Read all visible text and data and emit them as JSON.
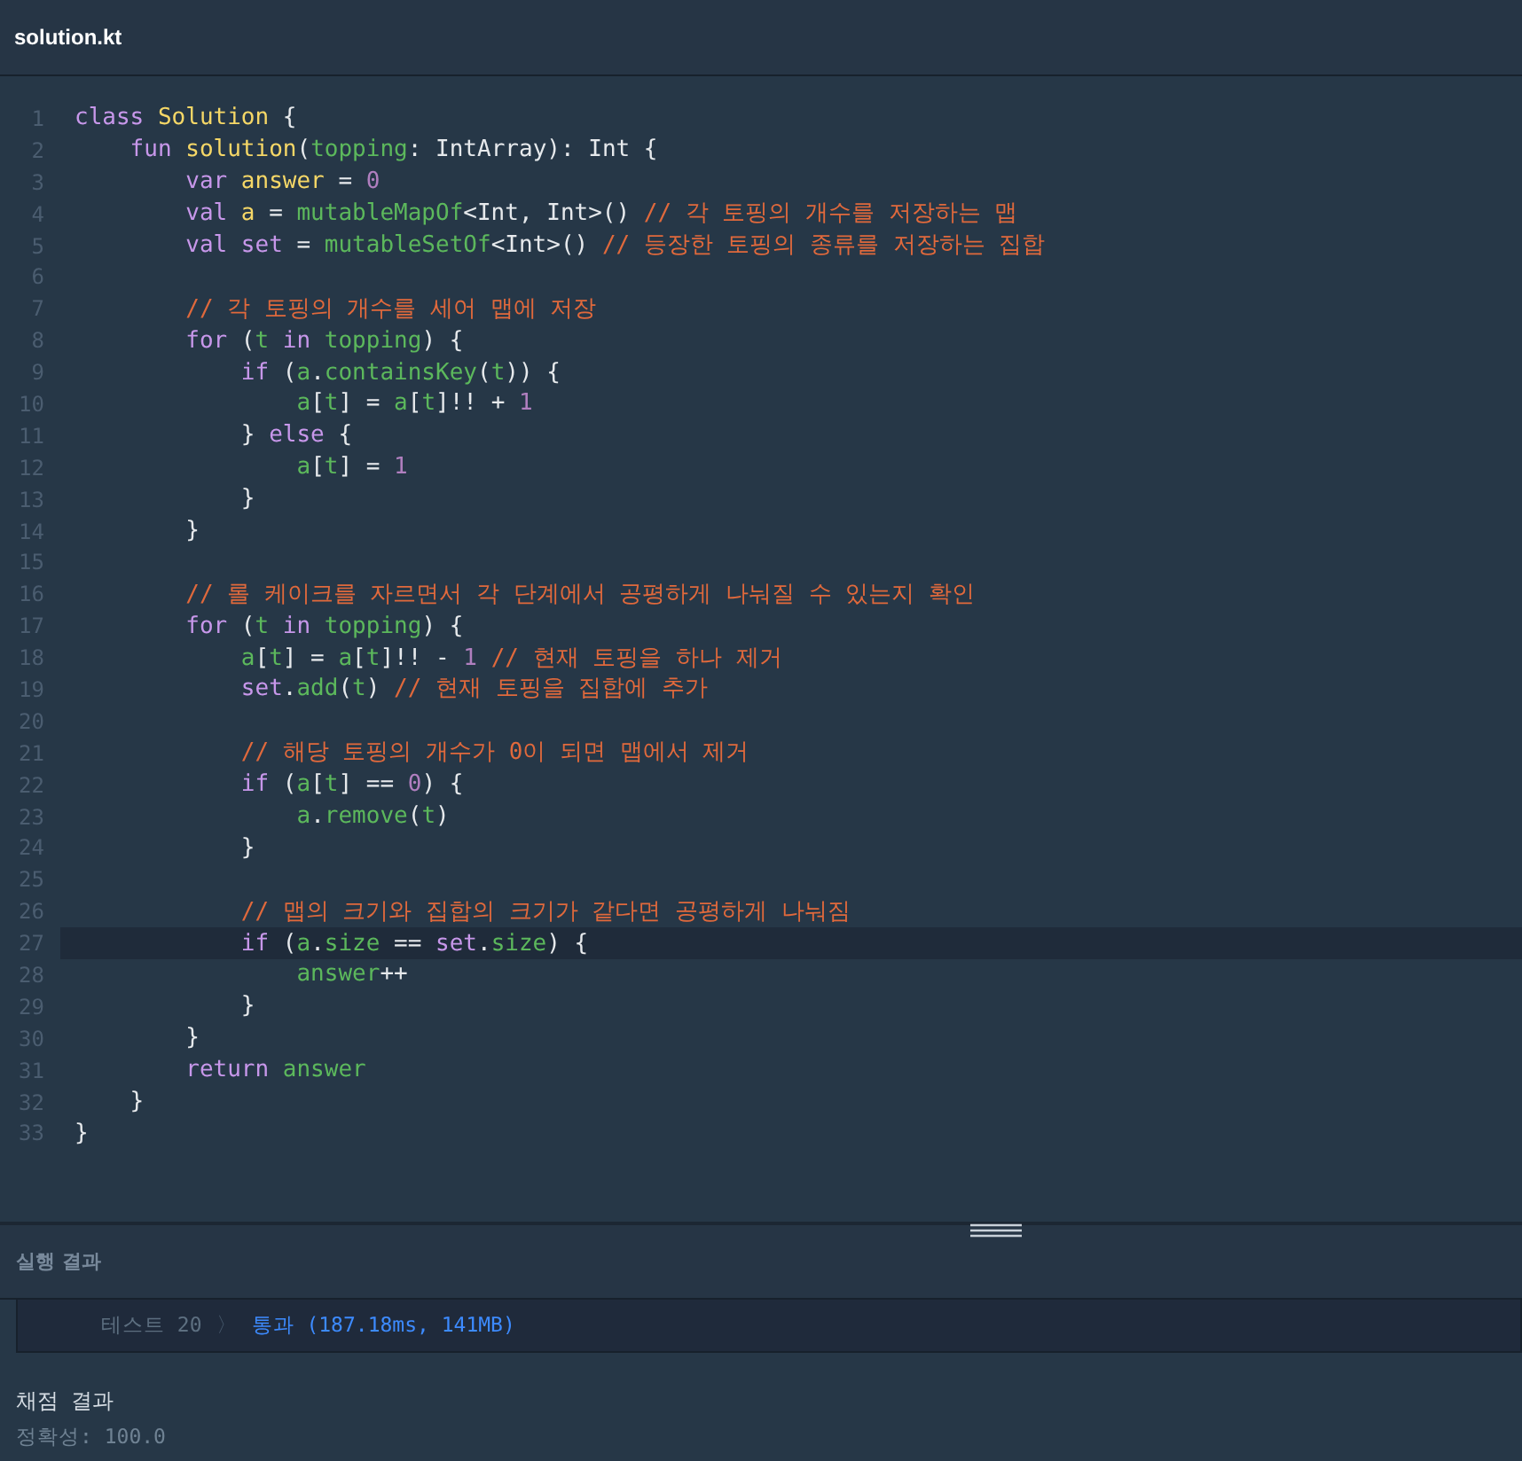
{
  "file_tab": {
    "title": "solution.kt"
  },
  "code_lines": [
    {
      "number": "1",
      "highlighted": false,
      "tokens": [
        {
          "kind": "keyword",
          "text": "class "
        },
        {
          "kind": "name",
          "text": "Solution"
        },
        {
          "kind": "plain",
          "text": " {"
        }
      ]
    },
    {
      "number": "2",
      "highlighted": false,
      "tokens": [
        {
          "kind": "keyword",
          "text": "    fun "
        },
        {
          "kind": "name",
          "text": "solution"
        },
        {
          "kind": "plain",
          "text": "("
        },
        {
          "kind": "ident",
          "text": "topping"
        },
        {
          "kind": "plain",
          "text": ": IntArray): Int {"
        }
      ]
    },
    {
      "number": "3",
      "highlighted": false,
      "tokens": [
        {
          "kind": "keyword",
          "text": "        var "
        },
        {
          "kind": "name",
          "text": "answer"
        },
        {
          "kind": "plain",
          "text": " = "
        },
        {
          "kind": "number",
          "text": "0"
        }
      ]
    },
    {
      "number": "4",
      "highlighted": false,
      "tokens": [
        {
          "kind": "keyword",
          "text": "        val "
        },
        {
          "kind": "name",
          "text": "a"
        },
        {
          "kind": "plain",
          "text": " = "
        },
        {
          "kind": "ident",
          "text": "mutableMapOf"
        },
        {
          "kind": "plain",
          "text": "<Int, Int>() "
        },
        {
          "kind": "comment",
          "text": "// 각 토핑의 개수를 저장하는 맵"
        }
      ]
    },
    {
      "number": "5",
      "highlighted": false,
      "tokens": [
        {
          "kind": "keyword",
          "text": "        val set"
        },
        {
          "kind": "plain",
          "text": " = "
        },
        {
          "kind": "ident",
          "text": "mutableSetOf"
        },
        {
          "kind": "plain",
          "text": "<Int>() "
        },
        {
          "kind": "comment",
          "text": "// 등장한 토핑의 종류를 저장하는 집합"
        }
      ]
    },
    {
      "number": "6",
      "highlighted": false
    },
    {
      "number": "7",
      "highlighted": false,
      "tokens": [
        {
          "kind": "comment",
          "text": "        // 각 토핑의 개수를 세어 맵에 저장"
        }
      ]
    },
    {
      "number": "8",
      "highlighted": false,
      "tokens": [
        {
          "kind": "keyword",
          "text": "        for "
        },
        {
          "kind": "plain",
          "text": "("
        },
        {
          "kind": "ident",
          "text": "t"
        },
        {
          "kind": "keyword",
          "text": " in "
        },
        {
          "kind": "ident",
          "text": "topping"
        },
        {
          "kind": "plain",
          "text": ") {"
        }
      ]
    },
    {
      "number": "9",
      "highlighted": false,
      "tokens": [
        {
          "kind": "keyword",
          "text": "            if "
        },
        {
          "kind": "plain",
          "text": "("
        },
        {
          "kind": "ident",
          "text": "a"
        },
        {
          "kind": "plain",
          "text": "."
        },
        {
          "kind": "ident",
          "text": "containsKey"
        },
        {
          "kind": "plain",
          "text": "("
        },
        {
          "kind": "ident",
          "text": "t"
        },
        {
          "kind": "plain",
          "text": ")) {"
        }
      ]
    },
    {
      "number": "10",
      "highlighted": false,
      "tokens": [
        {
          "kind": "ident",
          "text": "                a"
        },
        {
          "kind": "plain",
          "text": "["
        },
        {
          "kind": "ident",
          "text": "t"
        },
        {
          "kind": "plain",
          "text": "] = "
        },
        {
          "kind": "ident",
          "text": "a"
        },
        {
          "kind": "plain",
          "text": "["
        },
        {
          "kind": "ident",
          "text": "t"
        },
        {
          "kind": "plain",
          "text": "]!! + "
        },
        {
          "kind": "number",
          "text": "1"
        }
      ]
    },
    {
      "number": "11",
      "highlighted": false,
      "tokens": [
        {
          "kind": "plain",
          "text": "            } "
        },
        {
          "kind": "keyword",
          "text": "else "
        },
        {
          "kind": "plain",
          "text": "{"
        }
      ]
    },
    {
      "number": "12",
      "highlighted": false,
      "tokens": [
        {
          "kind": "ident",
          "text": "                a"
        },
        {
          "kind": "plain",
          "text": "["
        },
        {
          "kind": "ident",
          "text": "t"
        },
        {
          "kind": "plain",
          "text": "] = "
        },
        {
          "kind": "number",
          "text": "1"
        }
      ]
    },
    {
      "number": "13",
      "highlighted": false,
      "tokens": [
        {
          "kind": "plain",
          "text": "            }"
        }
      ]
    },
    {
      "number": "14",
      "highlighted": false,
      "tokens": [
        {
          "kind": "plain",
          "text": "        }"
        }
      ]
    },
    {
      "number": "15",
      "highlighted": false
    },
    {
      "number": "16",
      "highlighted": false,
      "tokens": [
        {
          "kind": "comment",
          "text": "        // 롤 케이크를 자르면서 각 단계에서 공평하게 나눠질 수 있는지 확인"
        }
      ]
    },
    {
      "number": "17",
      "highlighted": false,
      "tokens": [
        {
          "kind": "keyword",
          "text": "        for "
        },
        {
          "kind": "plain",
          "text": "("
        },
        {
          "kind": "ident",
          "text": "t"
        },
        {
          "kind": "keyword",
          "text": " in "
        },
        {
          "kind": "ident",
          "text": "topping"
        },
        {
          "kind": "plain",
          "text": ") {"
        }
      ]
    },
    {
      "number": "18",
      "highlighted": false,
      "tokens": [
        {
          "kind": "ident",
          "text": "            a"
        },
        {
          "kind": "plain",
          "text": "["
        },
        {
          "kind": "ident",
          "text": "t"
        },
        {
          "kind": "plain",
          "text": "] = "
        },
        {
          "kind": "ident",
          "text": "a"
        },
        {
          "kind": "plain",
          "text": "["
        },
        {
          "kind": "ident",
          "text": "t"
        },
        {
          "kind": "plain",
          "text": "]!! - "
        },
        {
          "kind": "number",
          "text": "1"
        },
        {
          "kind": "comment",
          "text": " // 현재 토핑을 하나 제거"
        }
      ]
    },
    {
      "number": "19",
      "highlighted": false,
      "tokens": [
        {
          "kind": "keyword",
          "text": "            set"
        },
        {
          "kind": "plain",
          "text": "."
        },
        {
          "kind": "ident",
          "text": "add"
        },
        {
          "kind": "plain",
          "text": "("
        },
        {
          "kind": "ident",
          "text": "t"
        },
        {
          "kind": "plain",
          "text": ") "
        },
        {
          "kind": "comment",
          "text": "// 현재 토핑을 집합에 추가"
        }
      ]
    },
    {
      "number": "20",
      "highlighted": false
    },
    {
      "number": "21",
      "highlighted": false,
      "tokens": [
        {
          "kind": "comment",
          "text": "            // 해당 토핑의 개수가 0이 되면 맵에서 제거"
        }
      ]
    },
    {
      "number": "22",
      "highlighted": false,
      "tokens": [
        {
          "kind": "keyword",
          "text": "            if "
        },
        {
          "kind": "plain",
          "text": "("
        },
        {
          "kind": "ident",
          "text": "a"
        },
        {
          "kind": "plain",
          "text": "["
        },
        {
          "kind": "ident",
          "text": "t"
        },
        {
          "kind": "plain",
          "text": "] == "
        },
        {
          "kind": "number",
          "text": "0"
        },
        {
          "kind": "plain",
          "text": ") {"
        }
      ]
    },
    {
      "number": "23",
      "highlighted": false,
      "tokens": [
        {
          "kind": "ident",
          "text": "                a"
        },
        {
          "kind": "plain",
          "text": "."
        },
        {
          "kind": "ident",
          "text": "remove"
        },
        {
          "kind": "plain",
          "text": "("
        },
        {
          "kind": "ident",
          "text": "t"
        },
        {
          "kind": "plain",
          "text": ")"
        }
      ]
    },
    {
      "number": "24",
      "highlighted": false,
      "tokens": [
        {
          "kind": "plain",
          "text": "            }"
        }
      ]
    },
    {
      "number": "25",
      "highlighted": false
    },
    {
      "number": "26",
      "highlighted": false,
      "tokens": [
        {
          "kind": "comment",
          "text": "            // 맵의 크기와 집합의 크기가 같다면 공평하게 나눠짐"
        }
      ]
    },
    {
      "number": "27",
      "highlighted": true,
      "tokens": [
        {
          "kind": "keyword",
          "text": "            if "
        },
        {
          "kind": "plain",
          "text": "("
        },
        {
          "kind": "ident",
          "text": "a"
        },
        {
          "kind": "plain",
          "text": "."
        },
        {
          "kind": "ident",
          "text": "size"
        },
        {
          "kind": "plain",
          "text": " == "
        },
        {
          "kind": "keyword",
          "text": "set"
        },
        {
          "kind": "plain",
          "text": "."
        },
        {
          "kind": "ident",
          "text": "size"
        },
        {
          "kind": "plain",
          "text": ") {"
        }
      ]
    },
    {
      "number": "28",
      "highlighted": false,
      "tokens": [
        {
          "kind": "ident",
          "text": "                answer"
        },
        {
          "kind": "plain",
          "text": "++"
        }
      ]
    },
    {
      "number": "29",
      "highlighted": false,
      "tokens": [
        {
          "kind": "plain",
          "text": "            }"
        }
      ]
    },
    {
      "number": "30",
      "highlighted": false,
      "tokens": [
        {
          "kind": "plain",
          "text": "        }"
        }
      ]
    },
    {
      "number": "31",
      "highlighted": false,
      "tokens": [
        {
          "kind": "keyword",
          "text": "        return "
        },
        {
          "kind": "ident",
          "text": "answer"
        }
      ]
    },
    {
      "number": "32",
      "highlighted": false,
      "tokens": [
        {
          "kind": "plain",
          "text": "    }"
        }
      ]
    },
    {
      "number": "33",
      "highlighted": false,
      "tokens": [
        {
          "kind": "plain",
          "text": "}"
        }
      ]
    }
  ],
  "run_panel": {
    "title": "실행 결과",
    "results": [
      {
        "test": "테스트 20",
        "chevron": "〉",
        "outcome": "통과 (187.18ms, 141MB)"
      }
    ]
  },
  "grading": {
    "title": "채점 결과",
    "accuracy": "정확성: 100.0"
  }
}
